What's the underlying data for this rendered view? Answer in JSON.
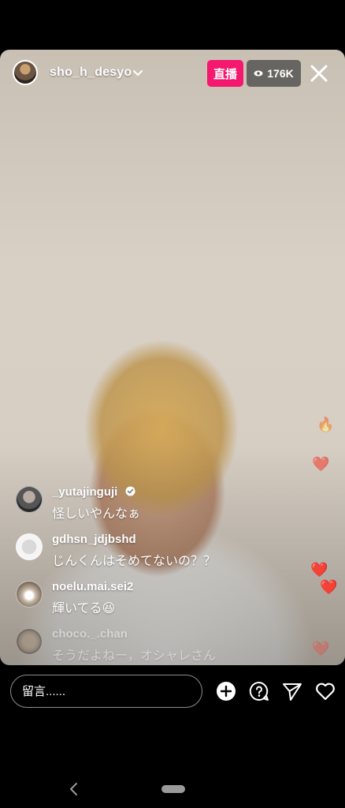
{
  "host": {
    "username": "sho_h_desyo",
    "live_label": "直播",
    "viewer_count": "176K"
  },
  "comments": [
    {
      "username": "_yutajinguji",
      "text": "怪しいやんなぁ",
      "verified": true,
      "faded": false
    },
    {
      "username": "gdhsn_jdjbshd",
      "text": "じんくんはそめてないの？？",
      "verified": false,
      "faded": false
    },
    {
      "username": "noelu.mai.sei2",
      "text": "輝いてる😆",
      "verified": false,
      "faded": false
    },
    {
      "username": "choco._.chan",
      "text": "そうだよねー，オシャレさん",
      "verified": false,
      "faded": true
    }
  ],
  "bottom_bar": {
    "comment_placeholder": "留言......"
  },
  "icons": [
    "chevron-down-icon",
    "eye-icon",
    "close-icon",
    "verified-icon",
    "add-icon",
    "question-icon",
    "send-icon",
    "heart-icon",
    "back-nav-icon"
  ],
  "colors": {
    "live_badge": "#f5186f",
    "background": "#000000"
  }
}
